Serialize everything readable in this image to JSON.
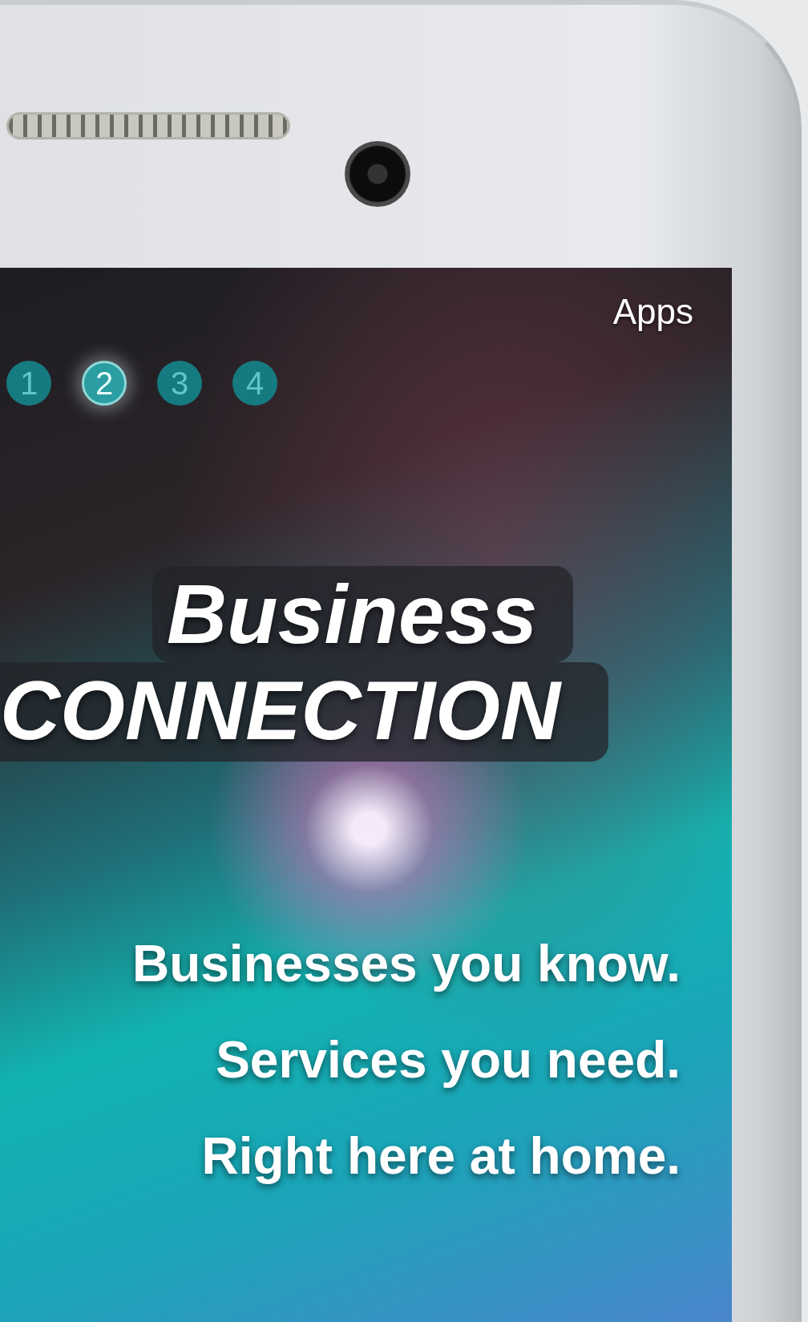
{
  "screen": {
    "apps_label": "Apps",
    "pages": [
      {
        "label": "1",
        "selected": false
      },
      {
        "label": "2",
        "selected": true
      },
      {
        "label": "3",
        "selected": false
      },
      {
        "label": "4",
        "selected": false
      }
    ],
    "headline": [
      "Business",
      "CONNECTION"
    ],
    "tagline": [
      "Businesses you know.",
      "Services you need.",
      "Right here at home."
    ]
  }
}
